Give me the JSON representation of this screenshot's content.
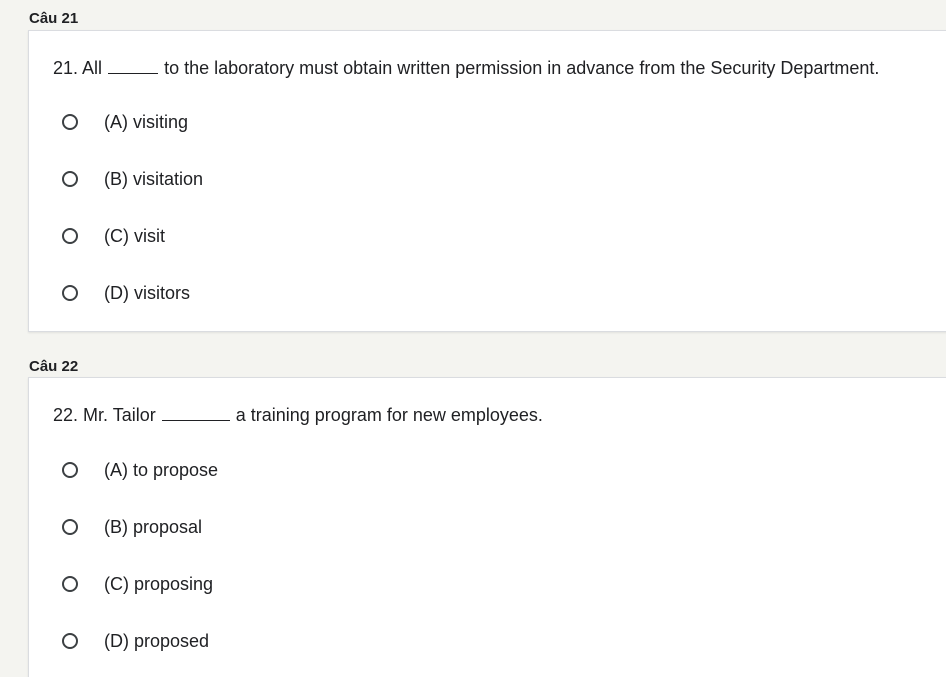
{
  "questions": [
    {
      "section_label": "Câu 21",
      "prefix": "21. All",
      "suffix": "to the laboratory must obtain written permission in advance from the Security Department.",
      "options": [
        "(A) visiting",
        "(B) visitation",
        "(C) visit",
        "(D) visitors"
      ]
    },
    {
      "section_label": "Câu 22",
      "prefix": "22. Mr. Tailor",
      "suffix": "a training program for new employees.",
      "options": [
        "(A) to propose",
        "(B) proposal",
        "(C) proposing",
        "(D) proposed"
      ]
    }
  ]
}
